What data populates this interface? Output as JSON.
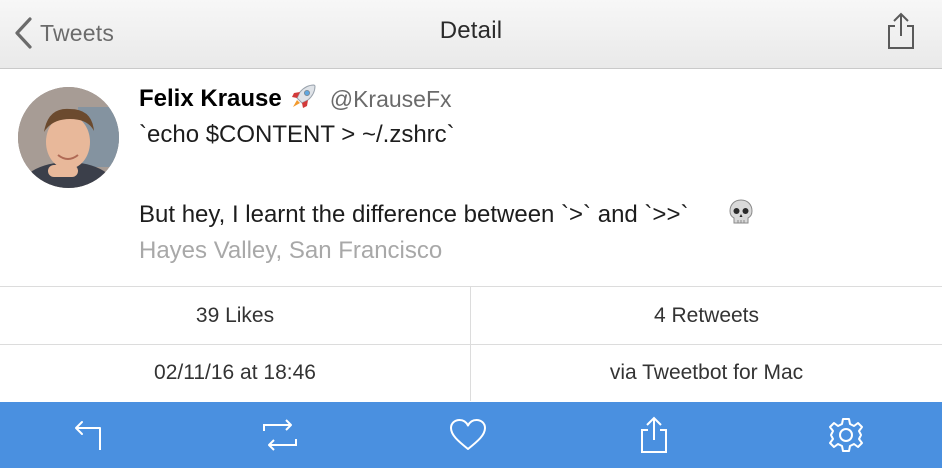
{
  "nav": {
    "back_label": "Tweets",
    "title": "Detail"
  },
  "tweet": {
    "author_name": "Felix Krause",
    "author_emoji": "rocket-emoji",
    "handle": "@KrauseFx",
    "line1": "`echo $CONTENT > ~/.zshrc`",
    "line2": "But hey, I learnt the difference between `>` and `>>`",
    "line2_emoji": "skull-emoji",
    "location": "Hayes Valley, San Francisco"
  },
  "stats": {
    "likes": "39 Likes",
    "retweets": "4 Retweets",
    "date": "02/11/16 at 18:46",
    "via": "via Tweetbot for Mac"
  },
  "toolbar": {
    "icons": [
      "reply-icon",
      "retweet-icon",
      "like-icon",
      "share-icon",
      "settings-icon"
    ]
  },
  "colors": {
    "toolbar_bg": "#4a90e0",
    "location_text": "#a8a8a8"
  }
}
